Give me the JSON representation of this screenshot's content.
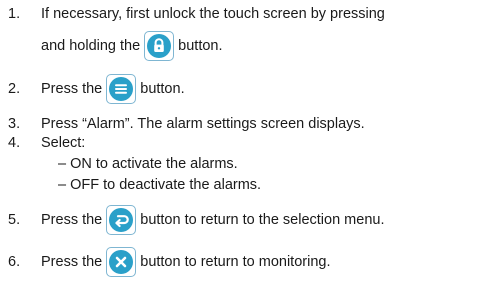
{
  "steps": [
    {
      "num": "1.",
      "line1": "If necessary, first unlock the touch screen by pressing",
      "pre": "and holding the",
      "post": "button.",
      "icon": "lock-icon"
    },
    {
      "num": "2.",
      "pre": "Press the",
      "post": "button.",
      "icon": "menu-icon"
    },
    {
      "num": "3.",
      "text": "Press “Alarm”. The alarm settings screen displays."
    },
    {
      "num": "4.",
      "text": "Select:",
      "sub": [
        "– ON to activate the alarms.",
        "– OFF to deactivate the alarms."
      ]
    },
    {
      "num": "5.",
      "pre": "Press the",
      "post": "button to return to the selection menu.",
      "icon": "return-icon"
    },
    {
      "num": "6.",
      "pre": "Press the",
      "post": "button to return to monitoring.",
      "icon": "close-icon"
    }
  ],
  "colors": {
    "icon_fill": "#2aa0c9",
    "icon_border": "#7fb6d2"
  }
}
